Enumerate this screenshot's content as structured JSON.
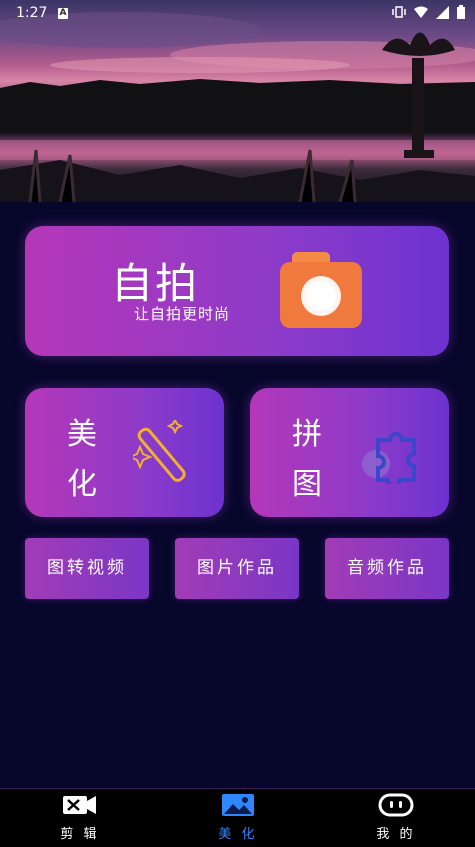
{
  "status": {
    "time": "1:27"
  },
  "hero": {
    "scene": "sunset-lake-with-lotus-lamp"
  },
  "main_card": {
    "title": "自拍",
    "subtitle": "让自拍更时尚",
    "icon": "camera-icon"
  },
  "beautify_card": {
    "line1": "美",
    "line2": "化",
    "icon": "magic-wand-icon"
  },
  "collage_card": {
    "line1": "拼",
    "line2": "图",
    "icon": "puzzle-icon"
  },
  "small_buttons": [
    "图转视频",
    "图片作品",
    "音频作品"
  ],
  "tabs": [
    {
      "label": "剪 辑",
      "icon": "clapper-scissors-icon"
    },
    {
      "label": "美 化",
      "icon": "image-icon",
      "active": true
    },
    {
      "label": "我 的",
      "icon": "robot-face-icon"
    }
  ],
  "colors": {
    "accent": "#2f86ff",
    "card_start": "#b537b8",
    "card_end": "#6d32d0",
    "background": "#07062b"
  }
}
